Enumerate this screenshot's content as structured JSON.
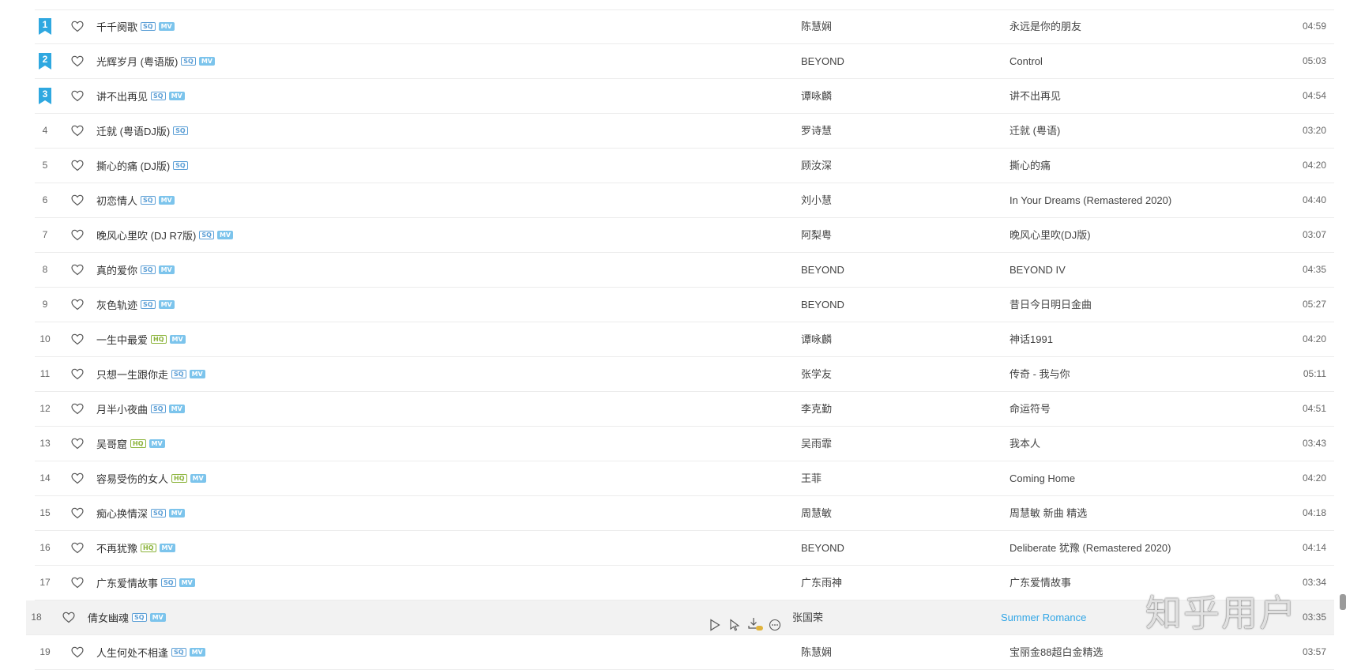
{
  "songs": [
    {
      "index": "1",
      "top": true,
      "title": "千千阕歌",
      "sq": true,
      "hq": false,
      "mv": true,
      "artist": "陈慧娴",
      "album": "永远是你的朋友",
      "duration": "04:59"
    },
    {
      "index": "2",
      "top": true,
      "title": "光辉岁月 (粤语版)",
      "sq": true,
      "hq": false,
      "mv": true,
      "artist": "BEYOND",
      "album": "Control",
      "duration": "05:03"
    },
    {
      "index": "3",
      "top": true,
      "title": "讲不出再见",
      "sq": true,
      "hq": false,
      "mv": true,
      "artist": "谭咏麟",
      "album": "讲不出再见",
      "duration": "04:54"
    },
    {
      "index": "4",
      "top": false,
      "title": "迁就 (粤语DJ版)",
      "sq": true,
      "hq": false,
      "mv": false,
      "artist": "罗诗慧",
      "album": "迁就 (粤语)",
      "duration": "03:20"
    },
    {
      "index": "5",
      "top": false,
      "title": "撕心的痛 (DJ版)",
      "sq": true,
      "hq": false,
      "mv": false,
      "artist": "顾汝深",
      "album": "撕心的痛",
      "duration": "04:20"
    },
    {
      "index": "6",
      "top": false,
      "title": "初恋情人",
      "sq": true,
      "hq": false,
      "mv": true,
      "artist": "刘小慧",
      "album": "In Your Dreams (Remastered 2020)",
      "duration": "04:40"
    },
    {
      "index": "7",
      "top": false,
      "title": "晚风心里吹 (DJ R7版)",
      "sq": true,
      "hq": false,
      "mv": true,
      "artist": "阿梨粤",
      "album": "晚风心里吹(DJ版)",
      "duration": "03:07"
    },
    {
      "index": "8",
      "top": false,
      "title": "真的爱你",
      "sq": true,
      "hq": false,
      "mv": true,
      "artist": "BEYOND",
      "album": "BEYOND IV",
      "duration": "04:35"
    },
    {
      "index": "9",
      "top": false,
      "title": "灰色轨迹",
      "sq": true,
      "hq": false,
      "mv": true,
      "artist": "BEYOND",
      "album": "昔日今日明日金曲",
      "duration": "05:27"
    },
    {
      "index": "10",
      "top": false,
      "title": "一生中最爱",
      "sq": false,
      "hq": true,
      "mv": true,
      "artist": "谭咏麟",
      "album": "神话1991",
      "duration": "04:20"
    },
    {
      "index": "11",
      "top": false,
      "title": "只想一生跟你走",
      "sq": true,
      "hq": false,
      "mv": true,
      "artist": "张学友",
      "album": "传奇 - 我与你",
      "duration": "05:11"
    },
    {
      "index": "12",
      "top": false,
      "title": "月半小夜曲",
      "sq": true,
      "hq": false,
      "mv": true,
      "artist": "李克勤",
      "album": "命运符号",
      "duration": "04:51"
    },
    {
      "index": "13",
      "top": false,
      "title": "吴哥窟",
      "sq": false,
      "hq": true,
      "mv": true,
      "artist": "吴雨霏",
      "album": "我本人",
      "duration": "03:43"
    },
    {
      "index": "14",
      "top": false,
      "title": "容易受伤的女人",
      "sq": false,
      "hq": true,
      "mv": true,
      "artist": "王菲",
      "album": "Coming Home",
      "duration": "04:20"
    },
    {
      "index": "15",
      "top": false,
      "title": "痴心换情深",
      "sq": true,
      "hq": false,
      "mv": true,
      "artist": "周慧敏",
      "album": "周慧敏 新曲 精选",
      "duration": "04:18"
    },
    {
      "index": "16",
      "top": false,
      "title": "不再犹豫",
      "sq": false,
      "hq": true,
      "mv": true,
      "artist": "BEYOND",
      "album": "Deliberate 犹豫 (Remastered 2020)",
      "duration": "04:14"
    },
    {
      "index": "17",
      "top": false,
      "title": "广东爱情故事",
      "sq": true,
      "hq": false,
      "mv": true,
      "artist": "广东雨神",
      "album": "广东爱情故事",
      "duration": "03:34"
    },
    {
      "index": "18",
      "top": false,
      "title": "倩女幽魂",
      "sq": true,
      "hq": false,
      "mv": true,
      "artist": "张国荣",
      "album": "Summer Romance",
      "duration": "03:35",
      "hover": true
    },
    {
      "index": "19",
      "top": false,
      "title": "人生何处不相逢",
      "sq": true,
      "hq": false,
      "mv": true,
      "artist": "陈慧娴",
      "album": "宝丽金88超白金精选",
      "duration": "03:57"
    }
  ],
  "badges": {
    "sq": "SQ",
    "hq": "HQ",
    "mv": "MV"
  },
  "colors": {
    "accent": "#31a6e6",
    "rank_badge": "#2fa8e0",
    "sq": "#5c9fd6",
    "hq": "#8bb33a",
    "mv": "#7cc4ec"
  },
  "icons": {
    "favorite": "heart-outline-icon",
    "rank": "bookmark-icon",
    "play": "play-icon",
    "add_to": "add-to-icon",
    "download": "download-icon",
    "more": "more-icon"
  },
  "watermark": "知乎用户"
}
